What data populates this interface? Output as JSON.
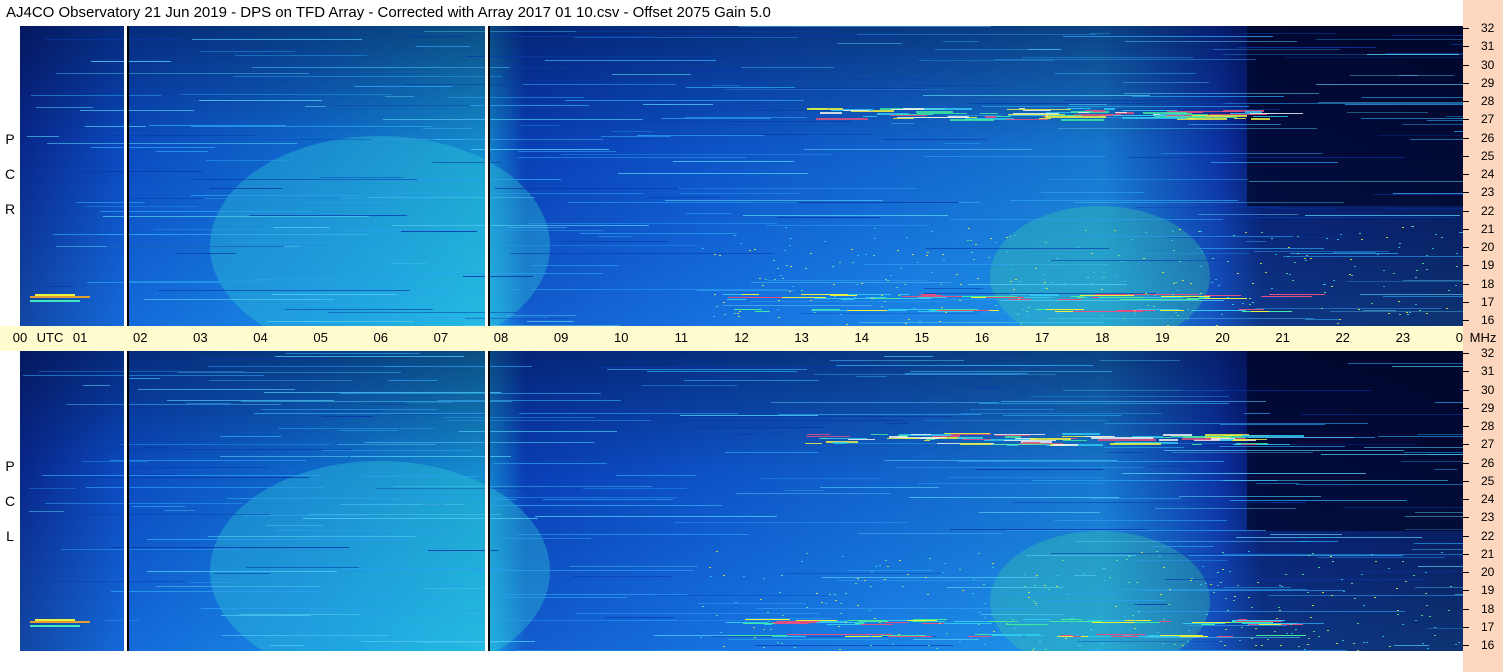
{
  "title": "AJ4CO Observatory  21 Jun 2019  -  DPS on TFD Array  -  Corrected with Array 2017 01 10.csv  -  Offset 2075  Gain 5.0",
  "panels": [
    {
      "name": "top",
      "polarization_letters": [
        "P",
        "C",
        "R"
      ]
    },
    {
      "name": "bottom",
      "polarization_letters": [
        "P",
        "C",
        "L"
      ]
    }
  ],
  "time_axis": {
    "labels": [
      "00",
      "01",
      "02",
      "03",
      "04",
      "05",
      "06",
      "07",
      "08",
      "09",
      "10",
      "11",
      "12",
      "13",
      "14",
      "15",
      "16",
      "17",
      "18",
      "19",
      "20",
      "21",
      "22",
      "23",
      "00"
    ],
    "utc_label": "UTC",
    "mhz_label": "MHz"
  },
  "freq_axis": {
    "labels": [
      "32",
      "31",
      "30",
      "29",
      "28",
      "27",
      "26",
      "25",
      "24",
      "23",
      "22",
      "21",
      "20",
      "19",
      "18",
      "17",
      "16"
    ]
  },
  "colors": {
    "background_dark": "#020a45",
    "mid_blue": "#0a4bd0",
    "cyan": "#1aa8e8",
    "hot": "#e04070",
    "yellow": "#e0f040",
    "axis_band": "#fffcd0",
    "right_band": "#fcd6bd"
  },
  "chart_data": {
    "type": "heatmap",
    "title": "AJ4CO Observatory  21 Jun 2019  -  DPS on TFD Array  -  Corrected with Array 2017 01 10.csv  -  Offset 2075  Gain 5.0",
    "xlabel": "UTC",
    "ylabel": "MHz",
    "x_range": [
      "00",
      "00"
    ],
    "y_range": [
      16,
      32
    ],
    "series": [
      {
        "name": "RCP",
        "brightest_band_mhz": 27,
        "brightest_time_utc": [
          "14",
          "20"
        ]
      },
      {
        "name": "LCP",
        "brightest_band_mhz": 27,
        "brightest_time_utc": [
          "14",
          "20"
        ]
      }
    ]
  }
}
